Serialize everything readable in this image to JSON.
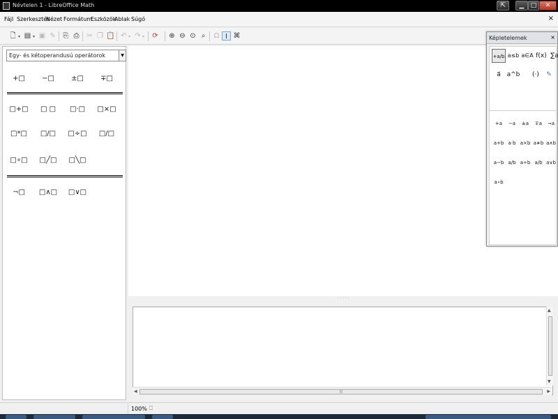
{
  "window": {
    "title": "Névtelen 1 - LibreOffice Math",
    "controls": {
      "restore_label": "⇱",
      "minimize_label": "▁",
      "maximize_label": "□",
      "close_label": "✕"
    }
  },
  "menubar": {
    "items": [
      "Fájl",
      "Szerkesztés",
      "Nézet",
      "Formátum",
      "Eszközök",
      "Ablak",
      "Súgó"
    ],
    "doc_close": "×"
  },
  "toolbar": {
    "icons": [
      "new-icon",
      "templates-icon",
      "save-icon",
      "edit-file-icon",
      "export-pdf-icon",
      "print-icon",
      "cut-icon",
      "copy-icon",
      "paste-icon",
      "undo-icon",
      "redo-icon",
      "update-icon",
      "zoom-in-icon",
      "zoom-out-icon",
      "zoom-100-icon",
      "show-all-icon",
      "symbols-icon",
      "formula-cursor-icon",
      "elements-toggle-icon"
    ]
  },
  "left_panel": {
    "category_select": {
      "value": "Egy- és kétoperandusú operátorok"
    },
    "unary": [
      "+□",
      "−□",
      "±□",
      "∓□"
    ],
    "binary": [
      "□+□",
      "□ □",
      "□·□",
      "□×□",
      "□*□",
      "□/□",
      "□÷□",
      "□∕□",
      "□∘□",
      "□╱□",
      "□╲□"
    ],
    "logic": [
      "¬□",
      "□∧□",
      "□∨□"
    ]
  },
  "command_window": {
    "text": ""
  },
  "statusbar": {
    "zoom": "100%",
    "signature": "⎕"
  },
  "elements_panel": {
    "title": "Képletelemek",
    "close_label": "×",
    "categories": [
      "+a/b",
      "a≤b",
      "a∈A",
      "f(x)",
      "∑a",
      "a⃗",
      "a^b",
      "(·)",
      "edit-icon"
    ],
    "ops": [
      "+a",
      "−a",
      "±a",
      "∓a",
      "¬a",
      "a+b",
      "a·b",
      "a×b",
      "a∗b",
      "a∧b",
      "a−b",
      "a/b",
      "a÷b",
      "a/b",
      "a∨b",
      "a∘b"
    ]
  },
  "colors": {
    "titlebar": "#000000",
    "panel": "#f0f0f0",
    "accent": "#7aa7d8"
  }
}
